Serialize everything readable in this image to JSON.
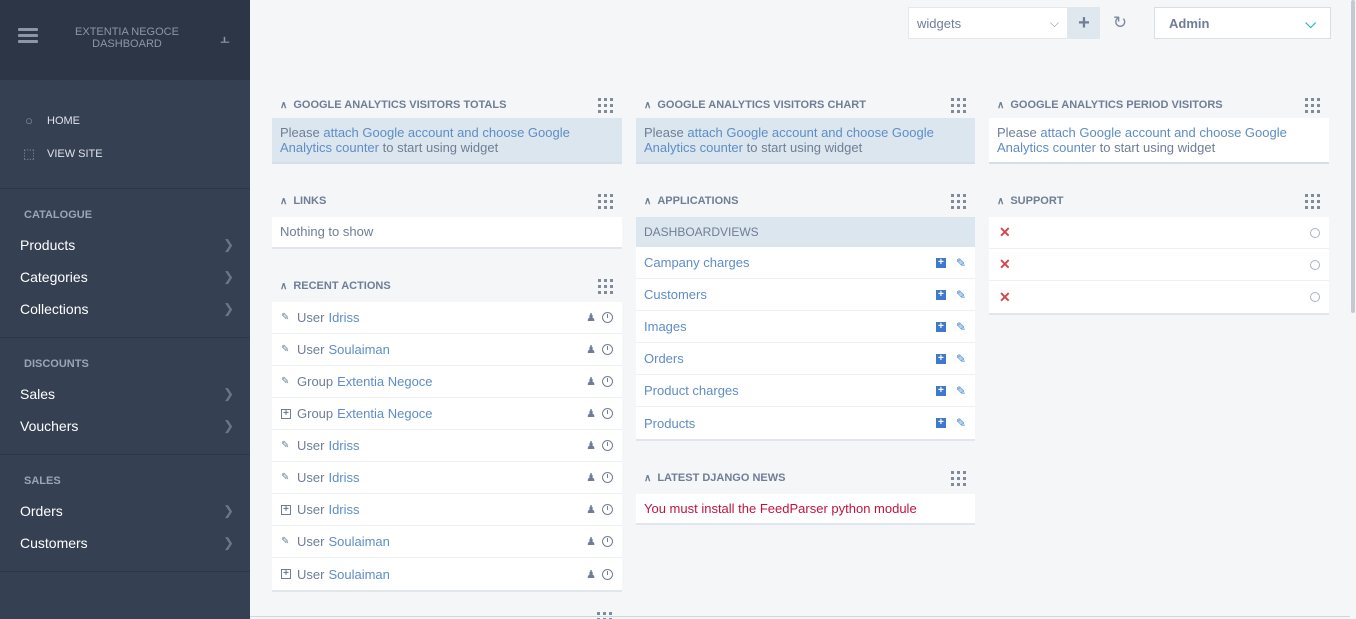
{
  "sidebar": {
    "brand": "EXTENTIA NEGOCE\nDASHBOARD",
    "top_links": [
      {
        "label": "HOME",
        "icon": "home-circle-icon"
      },
      {
        "label": "VIEW SITE",
        "icon": "external-site-icon"
      }
    ],
    "sections": [
      {
        "caption": "CATALOGUE",
        "items": [
          "Products",
          "Categories",
          "Collections"
        ]
      },
      {
        "caption": "DISCOUNTS",
        "items": [
          "Sales",
          "Vouchers"
        ]
      },
      {
        "caption": "SALES",
        "items": [
          "Orders",
          "Customers"
        ]
      }
    ]
  },
  "topbar": {
    "widgets_select": "widgets",
    "user_select": "Admin"
  },
  "widgets": {
    "ga_totals": {
      "title": "GOOGLE ANALYTICS VISITORS TOTALS",
      "pre": "Please ",
      "link": "attach Google account and choose Google Analytics counter",
      "post": " to start using widget"
    },
    "ga_chart": {
      "title": "GOOGLE ANALYTICS VISITORS CHART",
      "pre": "Please ",
      "link": "attach Google account and choose Google Analytics counter",
      "post": " to start using widget"
    },
    "ga_period": {
      "title": "GOOGLE ANALYTICS PERIOD VISITORS",
      "pre": "Please ",
      "link": "attach Google account and choose Google Analytics counter",
      "post": " to start using widget"
    },
    "links": {
      "title": "LINKS",
      "empty": "Nothing to show"
    },
    "recent_actions": {
      "title": "RECENT ACTIONS",
      "rows": [
        {
          "action": "change",
          "type": "User",
          "object": "Idriss"
        },
        {
          "action": "change",
          "type": "User",
          "object": "Soulaiman"
        },
        {
          "action": "change",
          "type": "Group",
          "object": "Extentia Negoce"
        },
        {
          "action": "add",
          "type": "Group",
          "object": "Extentia Negoce"
        },
        {
          "action": "change",
          "type": "User",
          "object": "Idriss"
        },
        {
          "action": "change",
          "type": "User",
          "object": "Idriss"
        },
        {
          "action": "add",
          "type": "User",
          "object": "Idriss"
        },
        {
          "action": "change",
          "type": "User",
          "object": "Soulaiman"
        },
        {
          "action": "add",
          "type": "User",
          "object": "Soulaiman"
        }
      ]
    },
    "applications": {
      "title": "APPLICATIONS",
      "group": "DASHBOARDVIEWS",
      "models": [
        "Campany charges",
        "Customers",
        "Images",
        "Orders",
        "Product charges",
        "Products"
      ]
    },
    "django_news": {
      "title": "LATEST DJANGO NEWS",
      "message": "You must install the FeedParser python module"
    },
    "support": {
      "title": "SUPPORT",
      "rows": 3
    }
  },
  "colors": {
    "sidebar_bg": "#354052",
    "link": "#5e8dc6",
    "error": "#c1143d",
    "accent": "#34b6c0"
  }
}
